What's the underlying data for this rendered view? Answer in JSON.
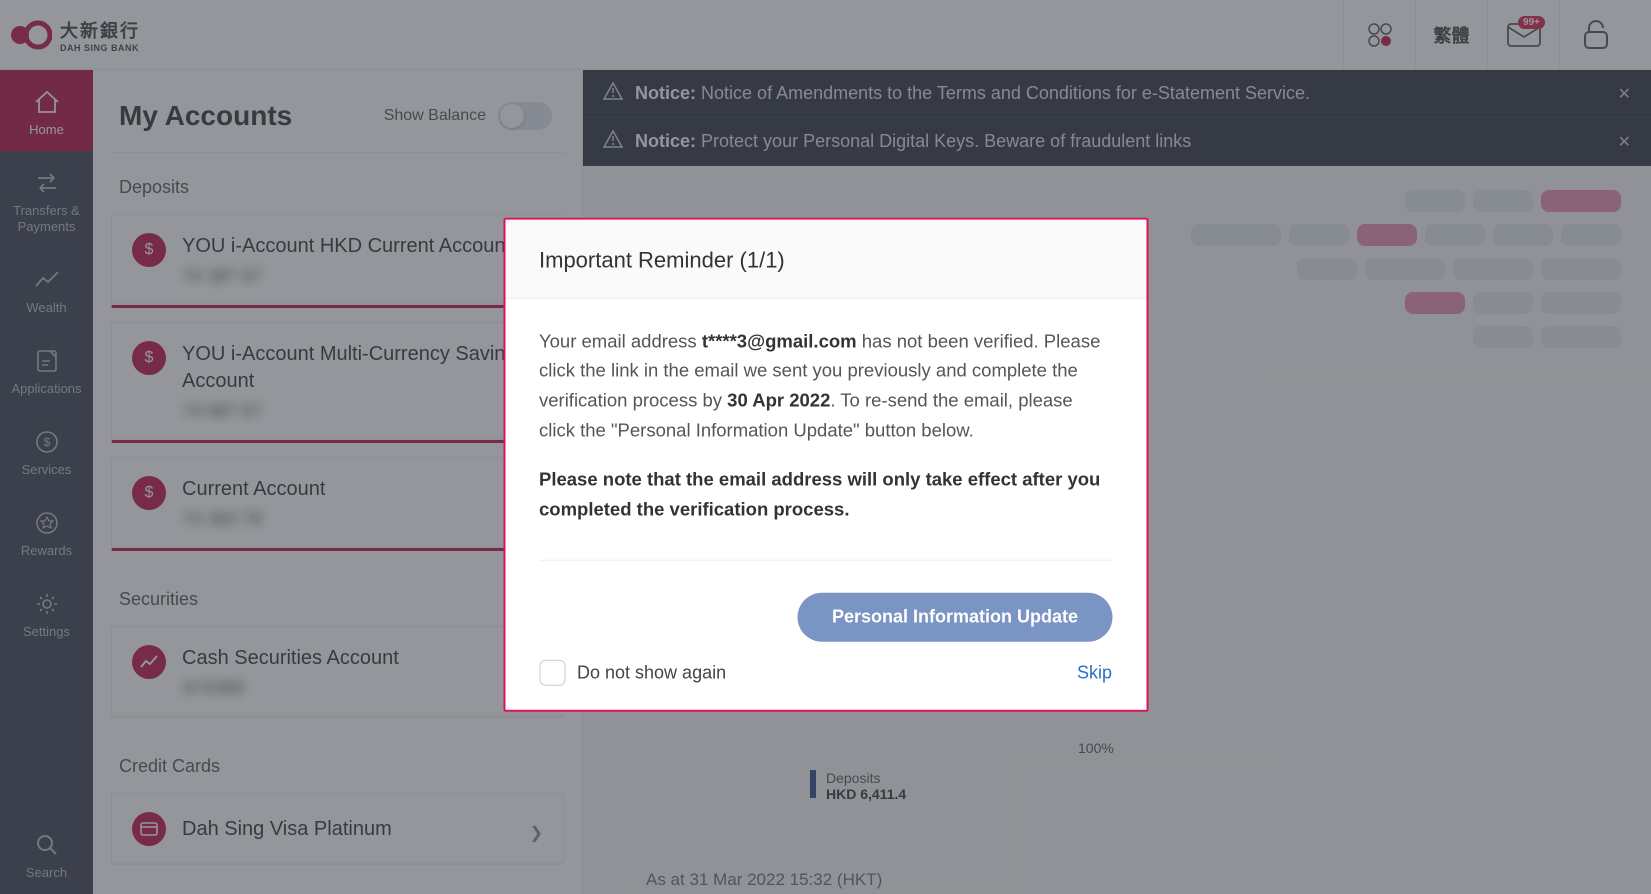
{
  "header": {
    "logo_cn": "大新銀行",
    "logo_en": "DAH SING BANK",
    "lang": "繁體",
    "notif_badge": "99+"
  },
  "sidebar": {
    "items": [
      {
        "label": "Home"
      },
      {
        "label": "Transfers & Payments"
      },
      {
        "label": "Wealth"
      },
      {
        "label": "Applications"
      },
      {
        "label": "Services"
      },
      {
        "label": "Rewards"
      },
      {
        "label": "Settings"
      }
    ],
    "search": "Search"
  },
  "accounts": {
    "title": "My Accounts",
    "show_balance": "Show Balance",
    "sections": {
      "deposits": "Deposits",
      "securities": "Securities",
      "credit": "Credit Cards"
    },
    "items": [
      {
        "title": "YOU i-Account HKD Current Account",
        "num": "74 387 67"
      },
      {
        "title": "YOU i-Account Multi-Currency Savings Account",
        "num": "74 887 67"
      },
      {
        "title": "Current Account",
        "num": "74 383 78"
      }
    ],
    "sec_item": {
      "title": "Cash Securities Account",
      "num": "A74389"
    },
    "cc_item": {
      "title": "Dah Sing Visa Platinum"
    }
  },
  "notices": [
    {
      "prefix": "Notice:",
      "text": "Notice of Amendments to the Terms and Conditions for e-Statement Service."
    },
    {
      "prefix": "Notice:",
      "text": "Protect your Personal Digital Keys. Beware of fraudulent links"
    }
  ],
  "chart": {
    "pct": "100%",
    "legend_label": "Deposits",
    "legend_value": "HKD 6,411.4",
    "timestamp": "As at 31 Mar 2022 15:32 (HKT)"
  },
  "modal": {
    "title": "Important Reminder (1/1)",
    "body_before_email": "Your email address ",
    "email": "t****3@gmail.com",
    "body_mid1": " has not been verified. Please click the link in the email we sent you previously and complete the verification process by ",
    "deadline": "30 Apr 2022",
    "body_mid2": ". To re-send the email, please click the \"Personal Information Update\" button below.",
    "body_bold": "Please note that the email address will only take effect after you completed the verification process.",
    "btn": "Personal Information Update",
    "checkbox": "Do not show again",
    "skip": "Skip"
  }
}
